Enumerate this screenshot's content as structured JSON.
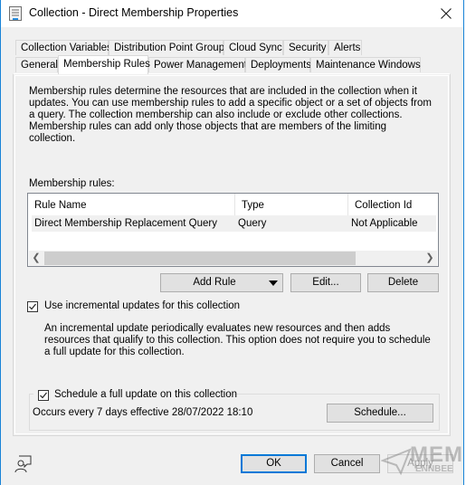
{
  "window": {
    "title": "Collection - Direct Membership Properties",
    "icon": "properties-window-icon",
    "close_icon": "close-icon"
  },
  "tabs": {
    "row1": [
      {
        "label": "Collection Variables"
      },
      {
        "label": "Distribution Point Groups"
      },
      {
        "label": "Cloud Sync"
      },
      {
        "label": "Security"
      },
      {
        "label": "Alerts"
      }
    ],
    "row2": [
      {
        "label": "General"
      },
      {
        "label": "Membership Rules",
        "active": true
      },
      {
        "label": "Power Management"
      },
      {
        "label": "Deployments"
      },
      {
        "label": "Maintenance Windows"
      }
    ]
  },
  "membership": {
    "description": "Membership rules determine the resources that are included in the collection when it updates. You can use membership rules to add a specific object or a set of objects from a query. The collection membership can also include or exclude other collections. Membership rules can add only those objects that are members of the limiting collection.",
    "rules_label": "Membership rules:",
    "columns": [
      "Rule Name",
      "Type",
      "Collection Id"
    ],
    "rows": [
      {
        "rule_name": "Direct Membership Replacement Query",
        "type": "Query",
        "collection_id": "Not Applicable"
      }
    ],
    "buttons": {
      "add_rule": "Add Rule",
      "edit": "Edit...",
      "delete": "Delete"
    }
  },
  "incremental": {
    "checked": true,
    "label": "Use incremental updates for this collection",
    "description": "An incremental update periodically evaluates new resources and then adds resources that qualify to this collection. This option does not require you to schedule a full update for this collection."
  },
  "full_update": {
    "checked": true,
    "label": "Schedule a full update on this collection",
    "schedule_text": "Occurs every 7 days effective 28/07/2022 18:10",
    "schedule_button": "Schedule..."
  },
  "footer": {
    "ok": "OK",
    "cancel": "Cancel",
    "apply": "Apply",
    "help_icon": "user-feedback-icon"
  },
  "watermark": {
    "line1": "MEM",
    "line2": "ENNBEE"
  }
}
